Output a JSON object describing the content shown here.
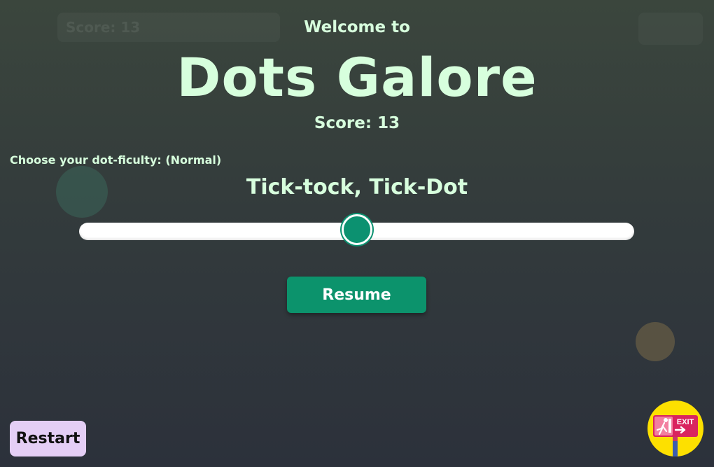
{
  "header": {
    "welcome_text": "Welcome to",
    "title": "Dots Galore",
    "score_text": "Score: 13",
    "background_score_text": "Score: 13"
  },
  "difficulty": {
    "label": "Choose your dot-ficulty: (Normal)",
    "name": "Tick-tock, Tick-Dot",
    "slider_value": 0.5
  },
  "buttons": {
    "resume": "Resume",
    "restart": "Restart",
    "exit_icon": "exit-sign-icon",
    "exit_sign_text": "EXIT"
  },
  "colors": {
    "text_accent": "#d7ffdd",
    "primary_green": "#0c936c",
    "restart_bg": "#e4cef5",
    "exit_bg": "#fde000"
  }
}
